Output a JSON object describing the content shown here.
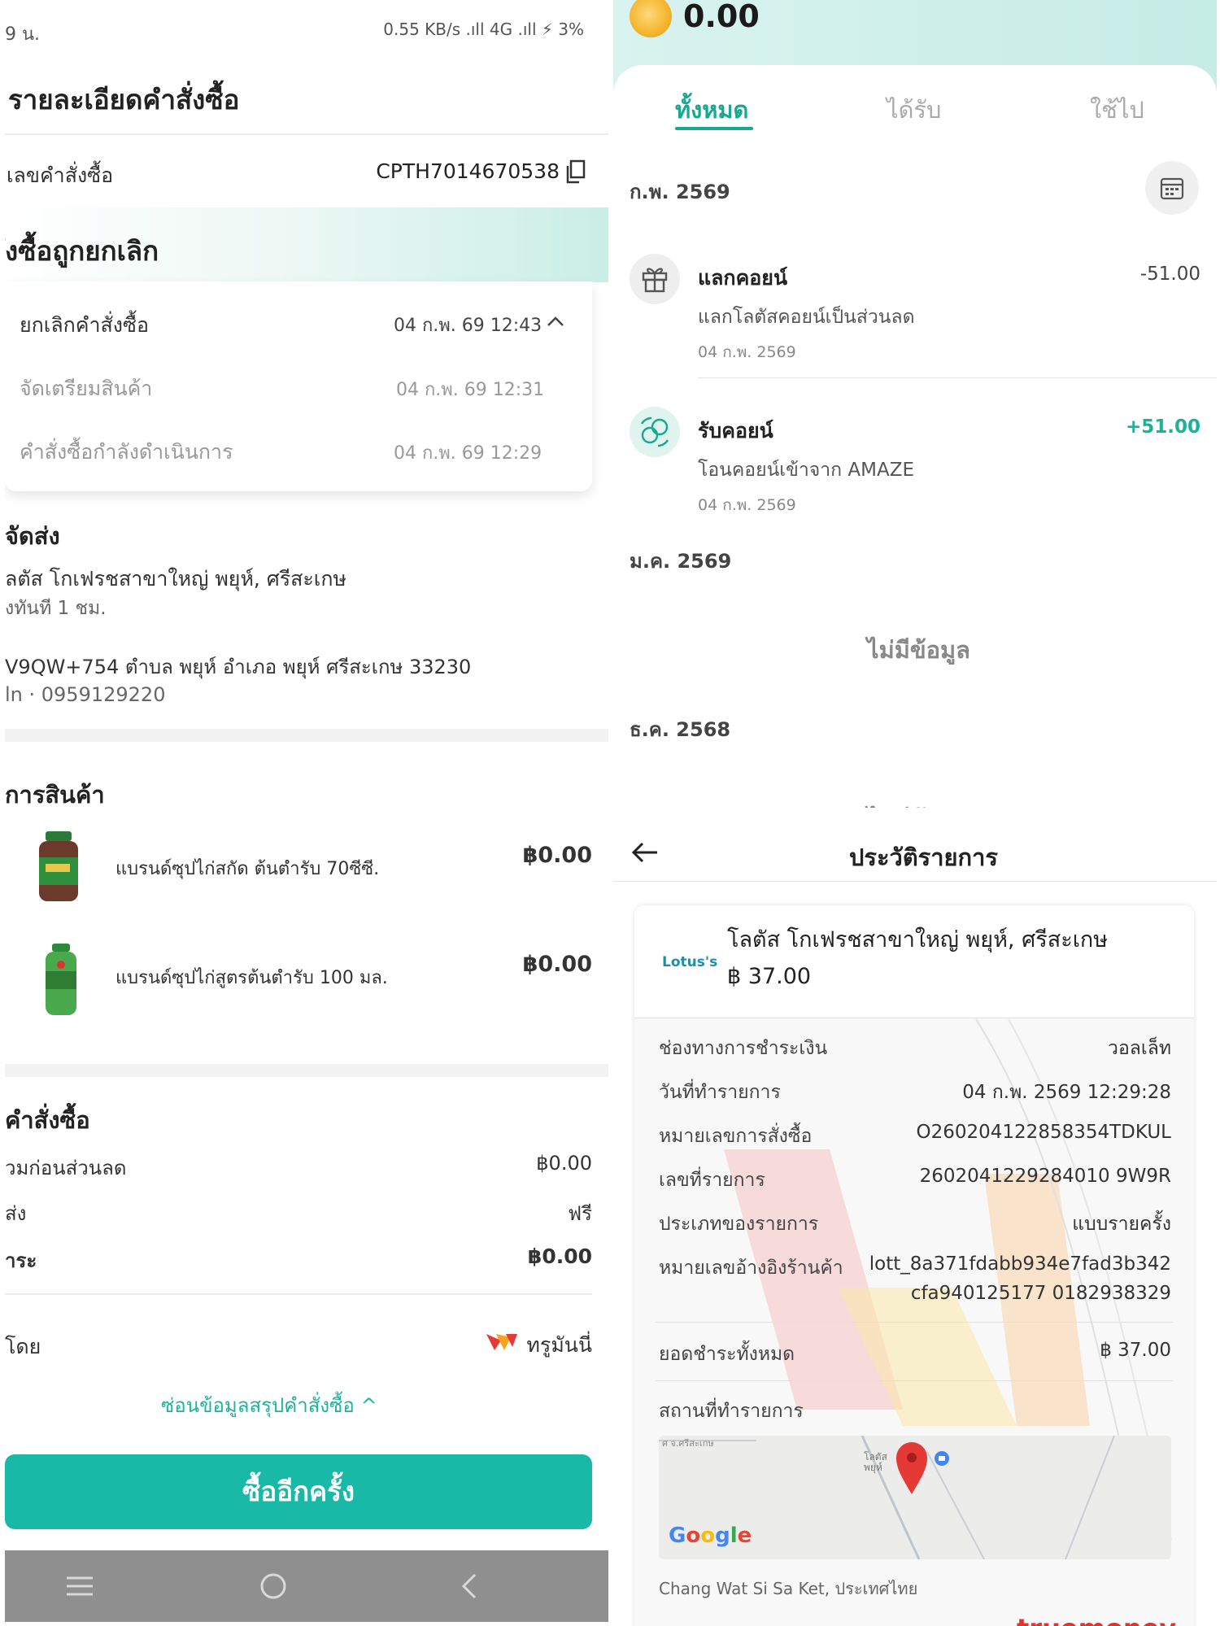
{
  "left": {
    "status_time": "9 น.",
    "status_right": "0.55 KB/s .ıll 4G .ıll ⚡ 3%",
    "title": "รายละเอียดคำสั่งซื้อ",
    "order_no_label": "เลขคำสั่งซื้อ",
    "order_no_value": "CPTH7014670538",
    "cancel_title": "ังซื้อถูกยกเลิก",
    "timeline": [
      {
        "label": "ยกเลิกคำสั่งซื้อ",
        "time": "04 ก.พ. 69 12:43"
      },
      {
        "label": "จัดเตรียมสินค้า",
        "time": "04 ก.พ. 69 12:31"
      },
      {
        "label": "คำสั่งซื้อกำลังดำเนินการ",
        "time": "04 ก.พ. 69 12:29"
      }
    ],
    "delivery_head": "จัดส่ง",
    "delivery_store": "ลตัส โกเฟรชสาขาใหญ่ พยุห์, ศรีสะเกษ",
    "delivery_eta": "งทันที 1 ชม.",
    "delivery_address": "V9QW+754 ตำบล พยุห์ อำเภอ พยุห์ ศรีสะเกษ 33230",
    "delivery_phone": "ln · 0959129220",
    "items_head": "การสินค้า",
    "items": [
      {
        "name": "แบรนด์ซุปไก่สกัด ต้นตำรับ 70ซีซี.",
        "price": "฿0.00"
      },
      {
        "name": "แบรนด์ซุปไก่สูตรต้นตำรับ 100 มล.",
        "price": "฿0.00"
      }
    ],
    "summary_head": "คำสั่งซื้อ",
    "summary_rows": [
      {
        "label": "วมก่อนส่วนลด",
        "value": "฿0.00"
      },
      {
        "label": "ส่ง",
        "value": "ฟรี"
      },
      {
        "label": "ำระ",
        "value": "฿0.00"
      }
    ],
    "pay_label": "โดย",
    "pay_value": "ทรูมันนี่",
    "hide_summary": "ซ่อนข้อมูลสรุปคำสั่งซื้อ ^",
    "buy_again": "ซื้ออีกครั้ง",
    "accent": "#19b9a8"
  },
  "rtop": {
    "balance": "0.00",
    "tabs": [
      "ทั้งหมด",
      "ได้รับ",
      "ใช้ไป"
    ],
    "months": [
      "ก.พ. 2569",
      "ม.ค. 2569",
      "ธ.ค. 2568"
    ],
    "no_data": "ไม่มีข้อมูล",
    "no_data_2": "ไม่มีข้อมูล",
    "transactions": [
      {
        "title": "แลกคอยน์",
        "amount": "-51.00",
        "desc": "แลกโลตัสคอยน์เป็นส่วนลด",
        "date": "04 ก.พ. 2569",
        "icon": "gift-icon"
      },
      {
        "title": "รับคอยน์",
        "amount": "+51.00",
        "desc": "โอนคอยน์เข้าจาก AMAZE",
        "date": "04 ก.พ. 2569",
        "icon": "coin-transfer-icon"
      }
    ],
    "accent": "#17a88f"
  },
  "rbot": {
    "title": "ประวัติรายการ",
    "logo": "Lotus's",
    "store": "โลตัส โกเฟรชสาขาใหญ่ พยุห์, ศรีสะเกษ",
    "amount": "฿ 37.00",
    "details": [
      {
        "label": "ช่องทางการชำระเงิน",
        "value": "วอลเล็ท"
      },
      {
        "label": "วันที่ทำรายการ",
        "value": "04 ก.พ. 2569 12:29:28"
      },
      {
        "label": "หมายเลขการสั่งซื้อ",
        "value": "O260204122858354TDKUL"
      },
      {
        "label": "เลขที่รายการ",
        "value": "2602041229284010 9W9R"
      },
      {
        "label": "ประเภทของรายการ",
        "value": "แบบรายครั้ง"
      },
      {
        "label": "หมายเลขอ้างอิงร้านค้า",
        "value": "lott_8a371fdabb934e7fad3b342",
        "value2": "cfa940125177 0182938329"
      }
    ],
    "total_label": "ยอดชำระทั้งหมด",
    "total_value": "฿ 37.00",
    "location_label": "สถานที่ทำรายการ",
    "map_pin_label": "โลตัส พยุห์",
    "map_top_text": "ศ จ.ศรีสะเกษ",
    "google": "Google",
    "place": "Chang Wat Si Sa Ket, ประเทศไทย",
    "truemoney": "truemoney"
  }
}
